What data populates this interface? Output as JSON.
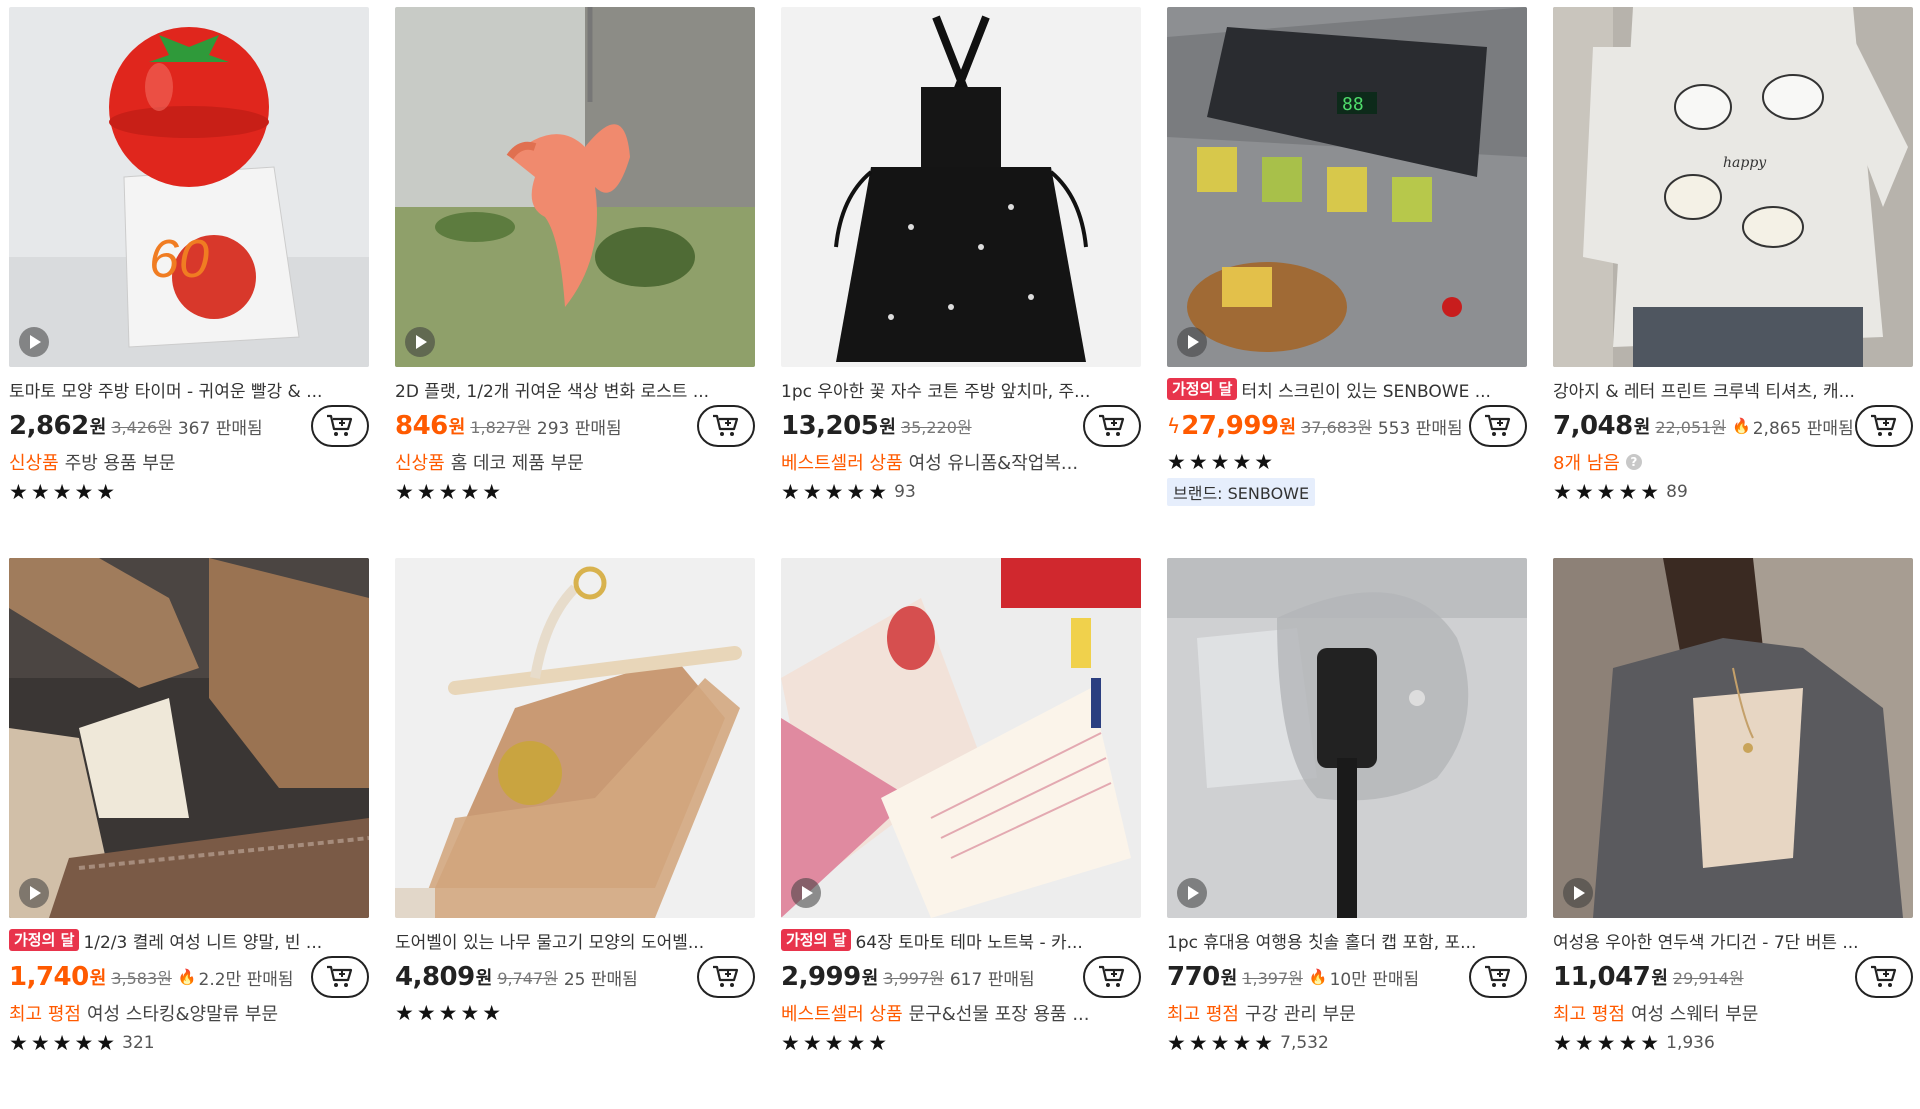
{
  "colors": {
    "accent": "#ff5a00",
    "tag_bg": "#e8344c",
    "brand_bg": "#e6eefc"
  },
  "icons": {
    "play": "play-icon",
    "cart": "add-to-cart-icon",
    "flame": "flame-icon",
    "lightning": "lightning-icon",
    "question": "question-icon"
  },
  "products": [
    {
      "title": "토마토 모양 주방 타이머 - 귀여운 빨강 & ...",
      "price": "2,862",
      "orange_price": false,
      "currency": "원",
      "original": "3,426원",
      "sold": "367 판매됨",
      "hl": "신상품",
      "category": "주방 용품 부문",
      "stars": "★★★★★",
      "rating": "",
      "video": true
    },
    {
      "title": "2D 플랫, 1/2개 귀여운 색상 변화 로스트 ...",
      "price": "846",
      "orange_price": true,
      "currency": "원",
      "original": "1,827원",
      "sold": "293 판매됨",
      "hl": "신상품",
      "category": "홈 데코 제품 부문",
      "stars": "★★★★★",
      "rating": "",
      "video": true
    },
    {
      "title": "1pc 우아한 꽃 자수 코튼 주방 앞치마, 주...",
      "price": "13,205",
      "orange_price": false,
      "currency": "원",
      "original": "35,220원",
      "sold": "",
      "hl": "베스트셀러 상품",
      "category": "여성 유니폼&작업복...",
      "stars": "★★★★★",
      "rating": "93",
      "video": false
    },
    {
      "tag": "가정의 달",
      "title": "터치 스크린이 있는 SENBOWE ...",
      "price": "27,999",
      "orange_price": true,
      "flash": "ϟ",
      "currency": "원",
      "original": "37,683원",
      "sold": "553 판매됨",
      "stars": "★★★★★",
      "rating": "",
      "brand": "브랜드: SENBOWE",
      "video": true
    },
    {
      "title": "강아지 & 레터 프린트 크루넥 티셔츠, 캐...",
      "price": "7,048",
      "orange_price": false,
      "currency": "원",
      "original": "22,051원",
      "sold": "2,865 판매됨",
      "fire": true,
      "hl": "8개 남음",
      "help": "?",
      "category": "",
      "stars": "★★★★★",
      "rating": "89",
      "video": false
    },
    {
      "tag": "가정의 달",
      "title": "1/2/3 켤레 여성 니트 양말, 빈 ...",
      "price": "1,740",
      "orange_price": true,
      "currency": "원",
      "original": "3,583원",
      "sold": "2.2만 판매됨",
      "fire": true,
      "hl": "최고 평점",
      "category": "여성 스타킹&양말류 부문",
      "stars": "★★★★★",
      "rating": "321",
      "video": true
    },
    {
      "title": "도어벨이 있는 나무 물고기 모양의 도어벨...",
      "price": "4,809",
      "orange_price": false,
      "currency": "원",
      "original": "9,747원",
      "sold": "25 판매됨",
      "stars": "★★★★★",
      "rating": "",
      "video": false
    },
    {
      "tag": "가정의 달",
      "title": "64장 토마토 테마 노트북 - 카...",
      "price": "2,999",
      "orange_price": false,
      "currency": "원",
      "original": "3,997원",
      "sold": "617 판매됨",
      "hl": "베스트셀러 상품",
      "category": "문구&선물 포장 용품 ...",
      "stars": "★★★★★",
      "rating": "",
      "video": true
    },
    {
      "title": "1pc 휴대용 여행용 칫솔 홀더 캡 포함, 포...",
      "price": "770",
      "orange_price": false,
      "currency": "원",
      "original": "1,397원",
      "sold": "10만 판매됨",
      "fire": true,
      "hl": "최고 평점",
      "category": "구강 관리 부문",
      "stars": "★★★★★",
      "rating": "7,532",
      "video": true
    },
    {
      "title": "여성용 우아한 연두색 가디건 - 7단 버튼 ...",
      "price": "11,047",
      "orange_price": false,
      "currency": "원",
      "original": "29,914원",
      "sold": "",
      "hl": "최고 평점",
      "category": "여성 스웨터 부문",
      "stars": "★★★★★",
      "rating": "1,936",
      "video": true
    }
  ]
}
